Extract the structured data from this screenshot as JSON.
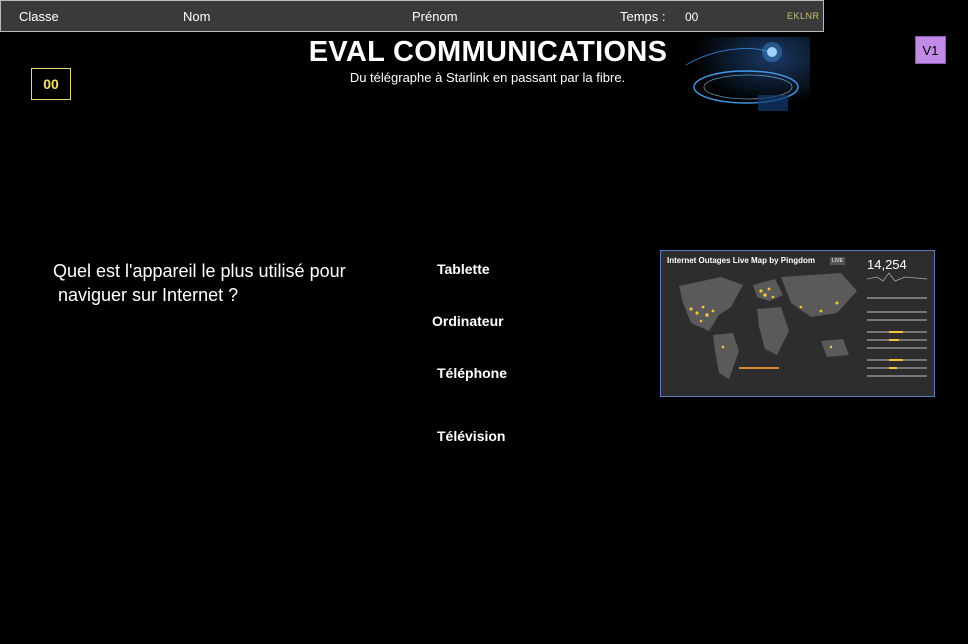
{
  "header": {
    "classe_label": "Classe",
    "nom_label": "Nom",
    "prenom_label": "Prénom",
    "temps_label": "Temps :",
    "temps_value": "00",
    "logo_text": "EKLNR"
  },
  "title": "EVAL COMMUNICATIONS",
  "subtitle": "Du télégraphe à Starlink en passant par la fibre.",
  "counter": "00",
  "version": "V1",
  "question": {
    "line1": "Quel est l'appareil le plus utilisé pour",
    "line2": "naviguer sur Internet ?"
  },
  "answers": [
    "Tablette",
    "Ordinateur",
    "Téléphone",
    "Télévision"
  ],
  "map_image": {
    "title": "Internet Outages Live Map by Pingdom",
    "badge": "LIVE",
    "count": "14,254"
  },
  "colors": {
    "background": "#000000",
    "topbar": "#3a3a3a",
    "counter_border": "#e6d86a",
    "version_bg": "#c28be8",
    "map_border": "#5a7fc0",
    "fiber_glow": "#4aa8ff"
  }
}
